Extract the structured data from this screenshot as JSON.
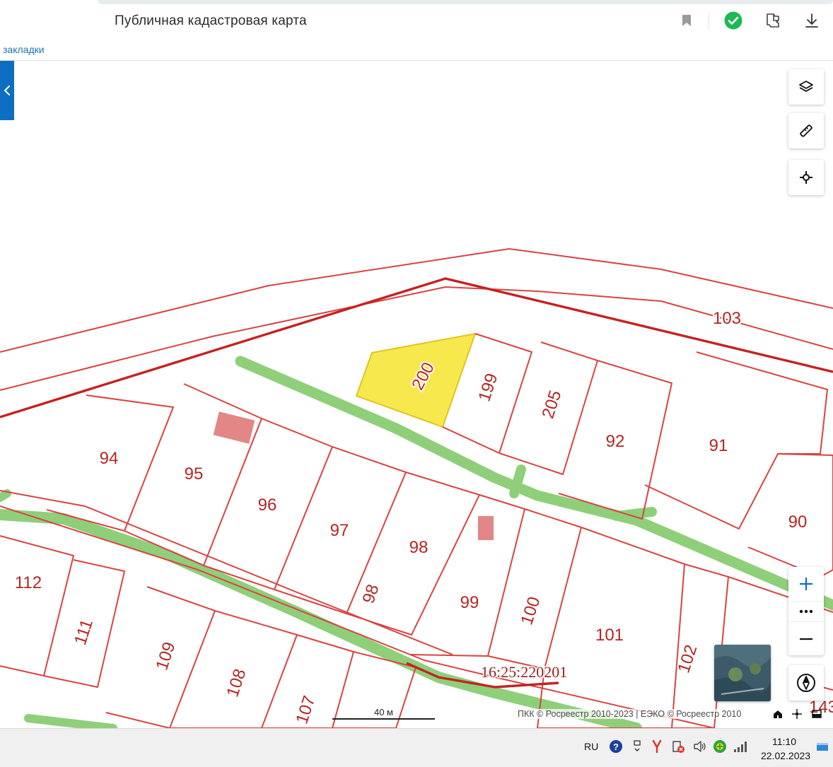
{
  "header": {
    "title": "Публичная кадастровая карта",
    "icons": [
      "bookmark-icon",
      "verified-check-icon",
      "extension-icon",
      "download-icon"
    ],
    "colors": {
      "check": "#1db954",
      "accent": "#0d6fc2"
    }
  },
  "bookmarks_bar": {
    "label": "закладки"
  },
  "map": {
    "quarter_number": "16:25:220201",
    "selected_parcel": "200",
    "parcel_labels": [
      "103",
      "200",
      "199",
      "205",
      "92",
      "91",
      "90",
      "94",
      "95",
      "96",
      "97",
      "98",
      "98",
      "99",
      "100",
      "101",
      "102",
      "112",
      "111",
      "109",
      "108",
      "107",
      "143"
    ],
    "scale_label": "40 м",
    "attribution": "ПКК © Росреестр 2010-2023 | ЕЭКО © Росреестр 2010",
    "controls": [
      "layers-icon",
      "ruler-icon",
      "locate-icon",
      "zoom-in-icon",
      "more-icon",
      "zoom-out-icon",
      "compass-icon"
    ],
    "colors": {
      "boundary": "#cc2b2b",
      "selected_fill": "#f7e94d",
      "road": "#8fcf7a"
    }
  },
  "taskbar": {
    "language": "RU",
    "time": "11:10",
    "date": "22.02.2023"
  }
}
